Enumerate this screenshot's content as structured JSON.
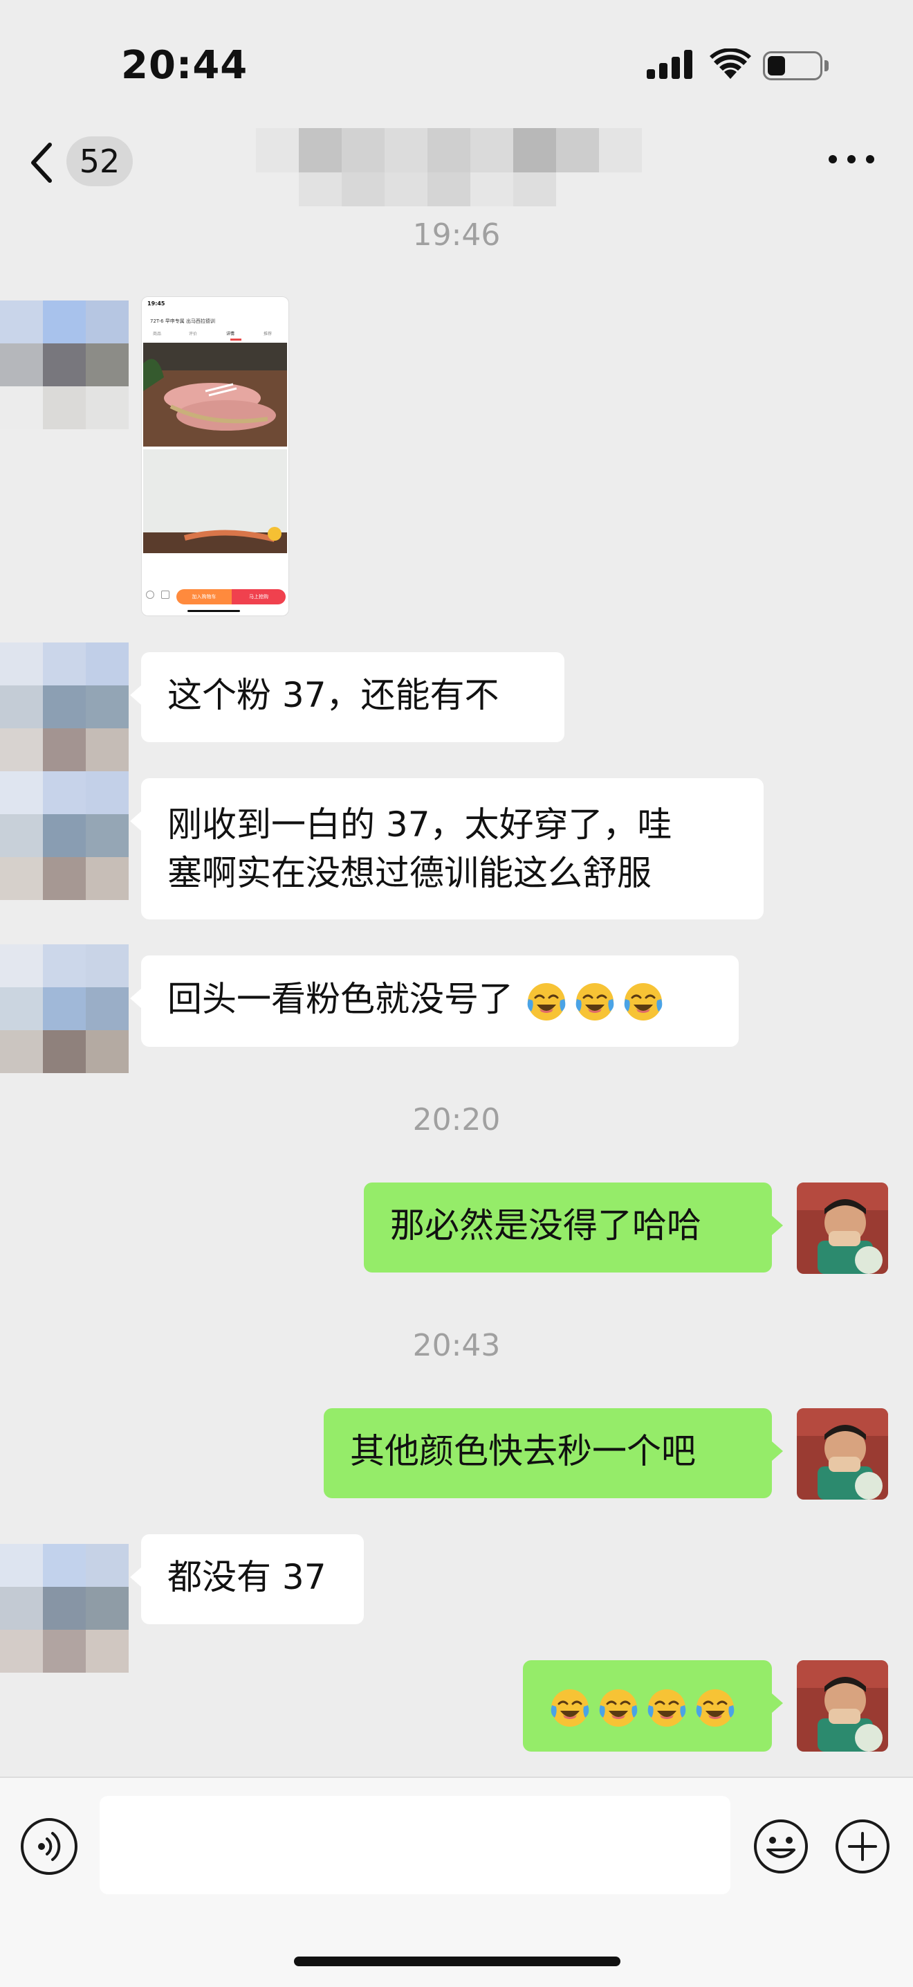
{
  "status_bar": {
    "time": "20:44",
    "icons": [
      "signal-icon",
      "wifi-icon",
      "battery-icon"
    ],
    "battery_level": 0.35
  },
  "nav": {
    "unread_count": "52",
    "icons": [
      "back-icon",
      "more-icon"
    ]
  },
  "colors": {
    "background": "#ededed",
    "incoming_bubble": "#ffffff",
    "outgoing_bubble": "#95ec69",
    "timestamp": "#a0a0a0"
  },
  "messages": {
    "time_1": "19:46",
    "shared_screenshot": {
      "status_time": "19:45",
      "title": "72T-6 早申专属 出马西拉德训",
      "tabs": [
        "商品",
        "评价",
        "详情",
        "推荐"
      ],
      "cart_button": "加入购物车",
      "buy_button": "马上抢购"
    },
    "in_1": "这个粉 37，还能有不",
    "in_2_line1": "刚收到一白的 37，太好穿了，哇",
    "in_2_line2": "塞啊实在没想过德训能这么舒服",
    "in_3": "回头一看粉色就没号了",
    "in_3_emojis": [
      "face-with-tears-of-joy-icon",
      "face-with-tears-of-joy-icon",
      "face-with-tears-of-joy-icon"
    ],
    "time_2": "20:20",
    "out_1": "那必然是没得了哈哈",
    "time_3": "20:43",
    "out_2": "其他颜色快去秒一个吧",
    "in_4": "都没有 37",
    "out_3_emojis": [
      "face-with-tears-of-joy-icon",
      "face-with-tears-of-joy-icon",
      "face-with-tears-of-joy-icon",
      "face-with-tears-of-joy-icon"
    ]
  },
  "input_bar": {
    "icons": [
      "voice-icon",
      "emoji-icon",
      "plus-icon"
    ]
  }
}
